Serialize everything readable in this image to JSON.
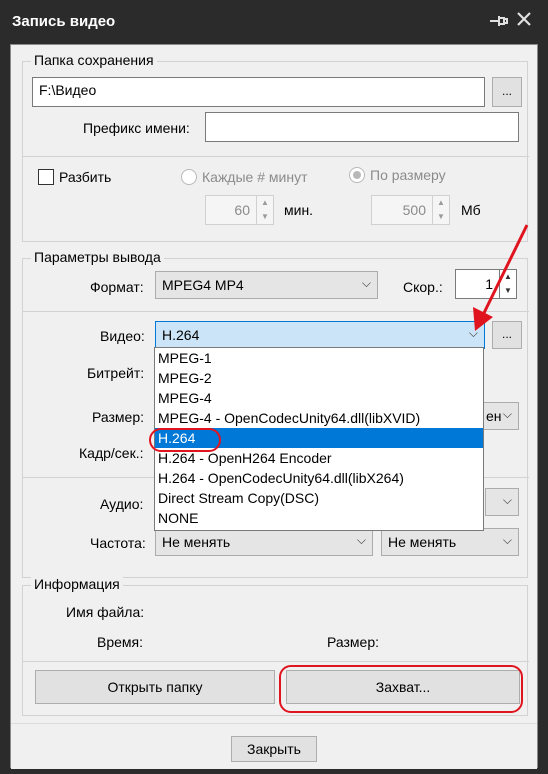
{
  "window": {
    "title": "Запись видео",
    "pin_icon": "pin-icon",
    "close_icon": "close-icon"
  },
  "save_folder": {
    "legend": "Папка сохранения",
    "path_value": "F:\\Видео",
    "browse_label": "...",
    "prefix_label": "Префикс имени:",
    "prefix_value": ""
  },
  "split": {
    "checkbox_label": "Разбить",
    "checked": false,
    "radio_minutes_label": "Каждые # минут",
    "radio_size_label": "По размеру",
    "minutes_value": "60",
    "minutes_unit": "мин.",
    "size_value": "500",
    "size_unit": "Мб"
  },
  "output": {
    "legend": "Параметры вывода",
    "format_label": "Формат:",
    "format_value": "MPEG4 MP4",
    "speed_label": "Скор.:",
    "speed_value": "1",
    "video_label": "Видео:",
    "video_value": "H.264",
    "video_settings_label": "...",
    "bitrate_label": "Битрейт:",
    "size_label": "Размер:",
    "size_partial": "ен",
    "fps_label": "Кадр/сек.:",
    "audio_label": "Аудио:",
    "freq_label": "Частота:",
    "freq_value": "Не менять",
    "freq_value2": "Не менять",
    "video_options": [
      "MPEG-1",
      "MPEG-2",
      "MPEG-4",
      "MPEG-4 - OpenCodecUnity64.dll(libXVID)",
      "H.264",
      "H.264 - OpenH264 Encoder",
      "H.264 - OpenCodecUnity64.dll(libX264)",
      "Direct Stream Copy(DSC)",
      "NONE"
    ],
    "selected_option_index": 4
  },
  "info": {
    "legend": "Информация",
    "filename_label": "Имя файла:",
    "time_label": "Время:",
    "filesize_label": "Размер:"
  },
  "actions": {
    "open_folder_label": "Открыть папку",
    "capture_label": "Захват...",
    "close_label": "Закрыть"
  },
  "colors": {
    "titlebar": "#2b2b2b",
    "selection": "#0078d7",
    "annotation": "#e0141e"
  }
}
